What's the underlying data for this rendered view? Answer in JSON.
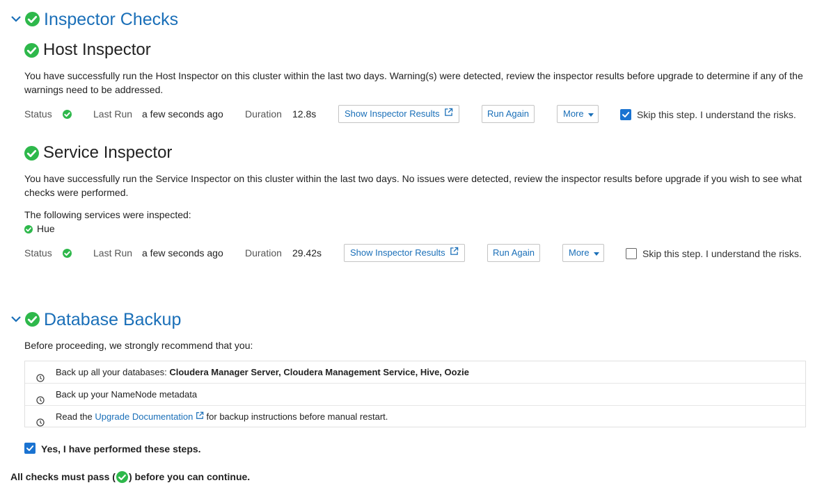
{
  "colors": {
    "accent": "#1a6fb8",
    "success": "#2eb84b",
    "checkbox": "#1a73d1"
  },
  "inspector_checks": {
    "title": "Inspector Checks",
    "host": {
      "title": "Host Inspector",
      "description": "You have successfully run the Host Inspector on this cluster within the last two days. Warning(s) were detected, review the inspector results before upgrade to determine if any of the warnings need to be addressed.",
      "status_label": "Status",
      "last_run_label": "Last Run",
      "last_run_value": "a few seconds ago",
      "duration_label": "Duration",
      "duration_value": "12.8s",
      "show_results": "Show Inspector Results",
      "run_again": "Run Again",
      "more": "More",
      "skip_label": "Skip this step. I understand the risks.",
      "skip_checked": true
    },
    "service": {
      "title": "Service Inspector",
      "description": "You have successfully run the Service Inspector on this cluster within the last two days. No issues were detected, review the inspector results before upgrade if you wish to see what checks were performed.",
      "services_intro": "The following services were inspected:",
      "services": [
        "Hue"
      ],
      "status_label": "Status",
      "last_run_label": "Last Run",
      "last_run_value": "a few seconds ago",
      "duration_label": "Duration",
      "duration_value": "29.42s",
      "show_results": "Show Inspector Results",
      "run_again": "Run Again",
      "more": "More",
      "skip_label": "Skip this step. I understand the risks.",
      "skip_checked": false
    }
  },
  "database_backup": {
    "title": "Database Backup",
    "intro": "Before proceeding, we strongly recommend that you:",
    "items": [
      {
        "prefix": "Back up all your databases: ",
        "bold": "Cloudera Manager Server, Cloudera Management Service, Hive, Oozie"
      },
      {
        "text": "Back up your NameNode metadata"
      },
      {
        "prefix": "Read the ",
        "link": "Upgrade Documentation",
        "suffix": " for backup instructions before manual restart."
      }
    ],
    "confirm_label": "Yes, I have performed these steps.",
    "confirm_checked": true
  },
  "footer": {
    "prefix": "All checks must pass (",
    "suffix": ") before you can continue."
  }
}
